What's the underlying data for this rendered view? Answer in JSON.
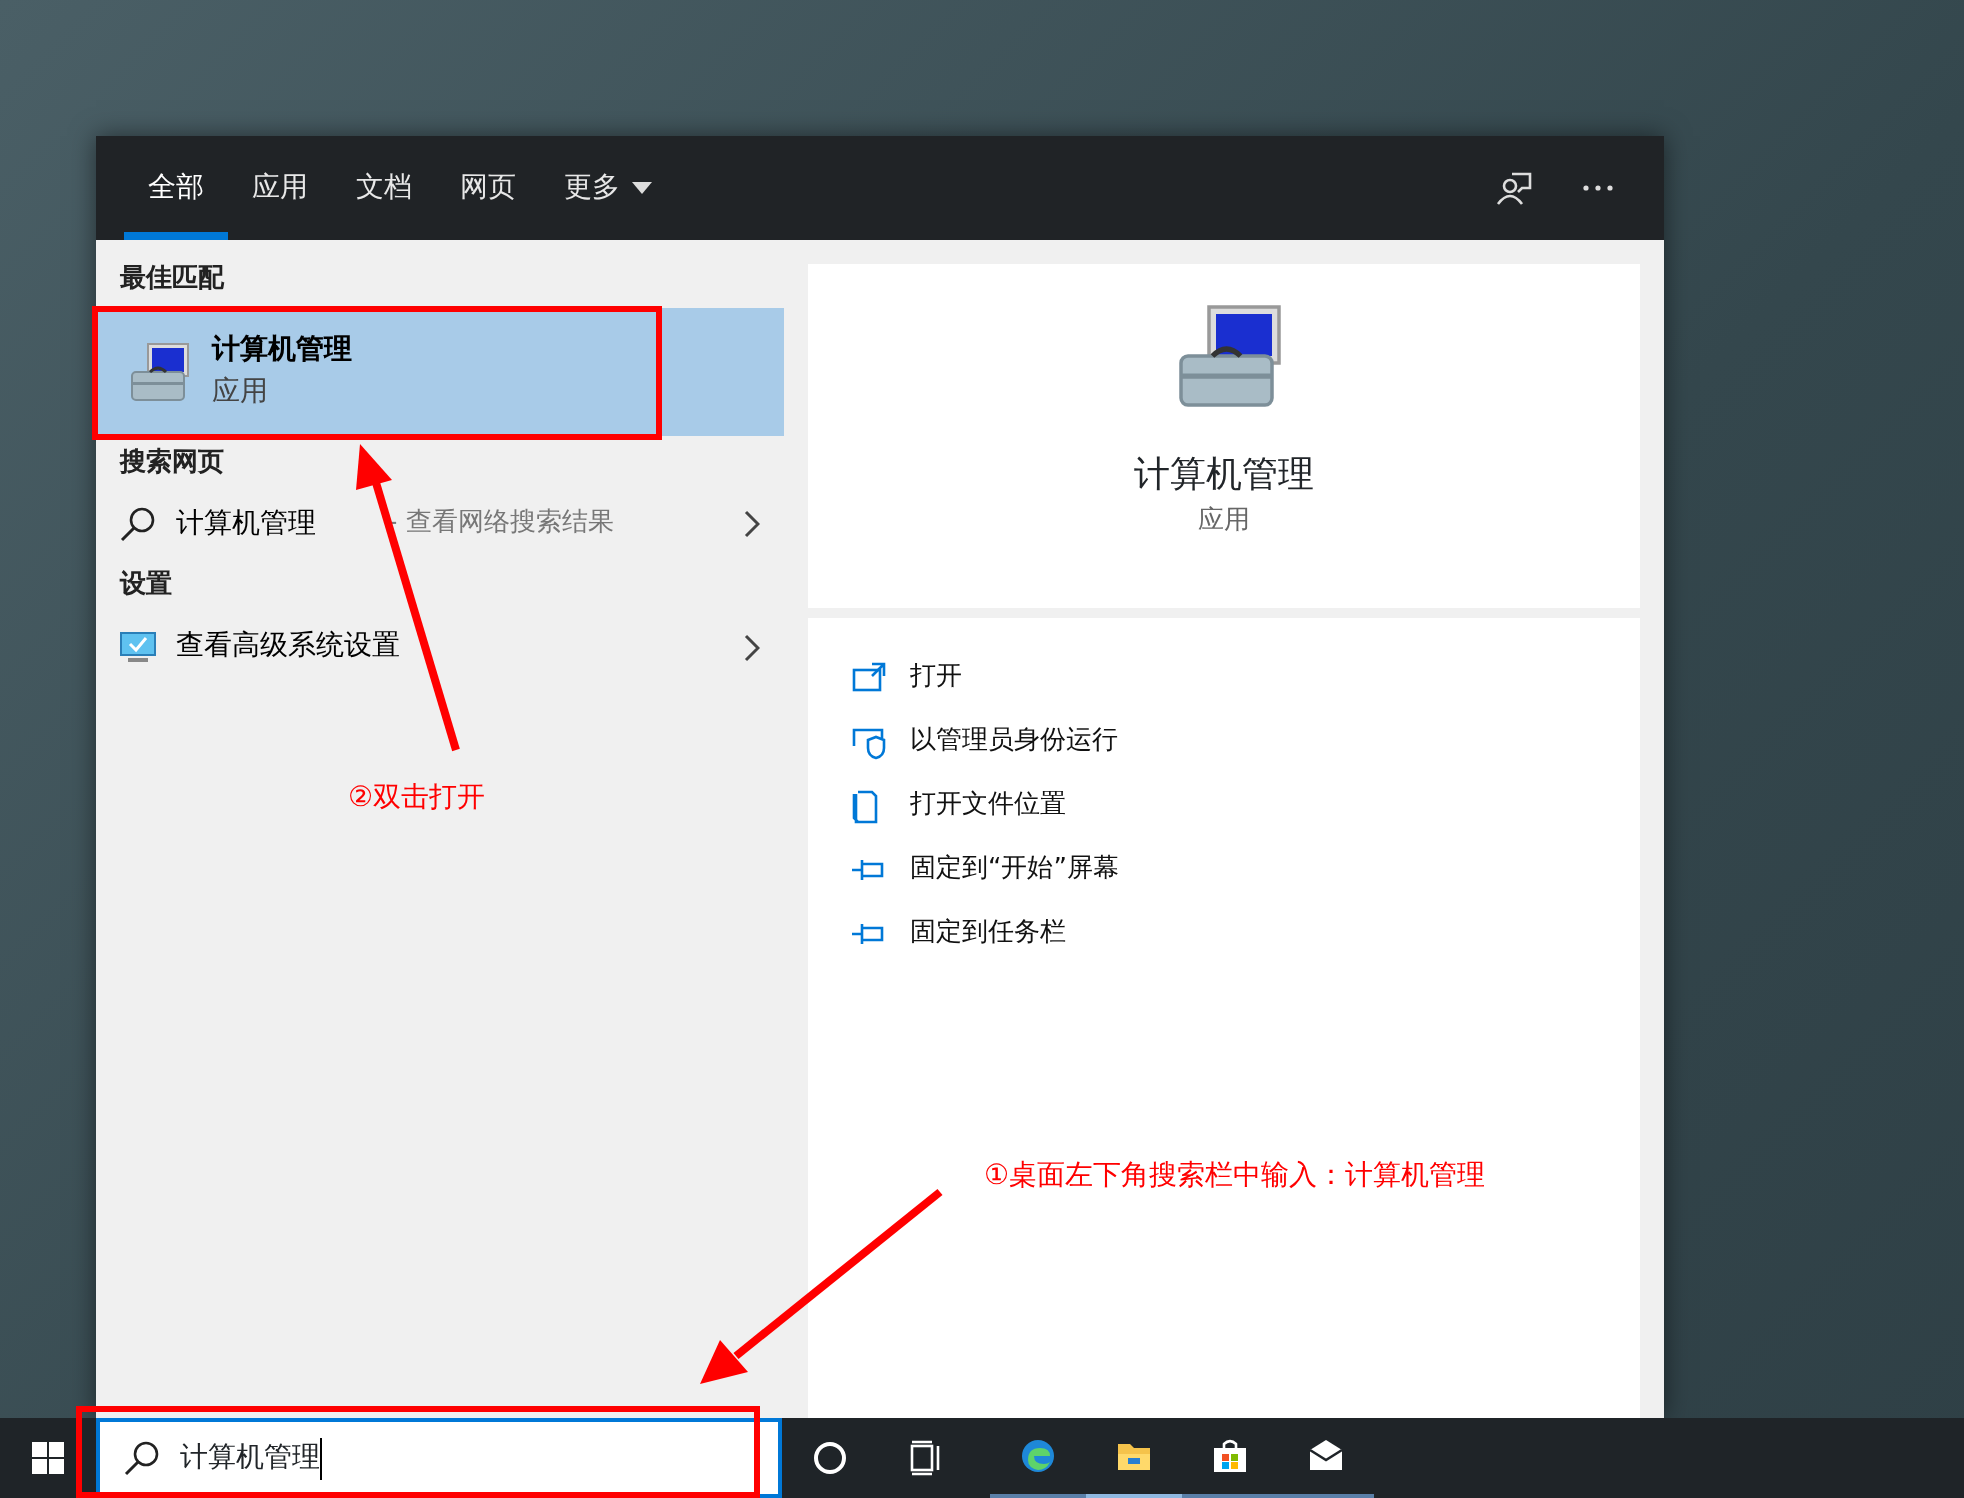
{
  "tabs": [
    {
      "label": "全部",
      "selected": true,
      "kind": "plain"
    },
    {
      "label": "应用",
      "selected": false,
      "kind": "plain"
    },
    {
      "label": "文档",
      "selected": false,
      "kind": "plain"
    },
    {
      "label": "网页",
      "selected": false,
      "kind": "plain"
    },
    {
      "label": "更多",
      "selected": false,
      "kind": "dropdown"
    }
  ],
  "sections": [
    {
      "heading": "最佳匹配",
      "items": [
        {
          "kind": "app",
          "title": "计算机管理",
          "subtitle": "应用",
          "selected": true
        }
      ]
    },
    {
      "heading": "搜索网页",
      "items": [
        {
          "kind": "web",
          "title": "计算机管理",
          "hint": "- 查看网络搜索结果",
          "selected": false
        }
      ]
    },
    {
      "heading": "设置",
      "items": [
        {
          "kind": "setting",
          "title": "查看高级系统设置",
          "selected": false
        }
      ]
    }
  ],
  "detail": {
    "title": "计算机管理",
    "subtitle": "应用",
    "actions": [
      {
        "kind": "open",
        "label": "打开"
      },
      {
        "kind": "admin",
        "label": "以管理员身份运行"
      },
      {
        "kind": "folder",
        "label": "打开文件位置"
      },
      {
        "kind": "pin",
        "label": "固定到“开始”屏幕"
      },
      {
        "kind": "pin",
        "label": "固定到任务栏"
      }
    ]
  },
  "search_box": {
    "value": "计算机管理"
  },
  "annotations": [
    {
      "kind": "step",
      "text": "②双击打开"
    },
    {
      "kind": "step",
      "text": "①桌面左下角搜索栏中输入：计算机管理"
    }
  ]
}
